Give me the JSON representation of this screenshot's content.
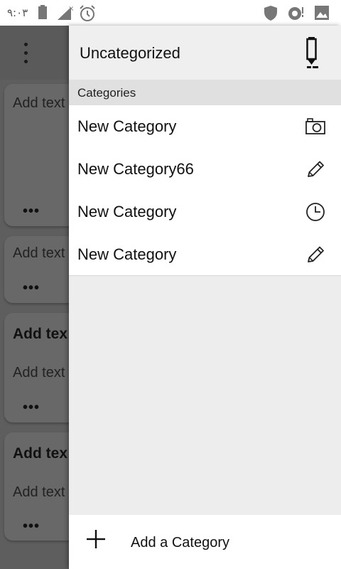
{
  "status_bar": {
    "time": "۹:۰۳",
    "icons": [
      "battery-icon",
      "no-signal-icon",
      "alarm-icon",
      "shield-icon",
      "sync-icon",
      "image-icon"
    ]
  },
  "background": {
    "menu_icon": "overflow-menu-icon",
    "cards": [
      {
        "title": "",
        "text": "Add text",
        "more": "•••"
      },
      {
        "title": "",
        "text": "Add text",
        "more": "•••"
      },
      {
        "title": "Add tex",
        "text": "Add text",
        "more": "•••"
      },
      {
        "title": "Add tex",
        "text": "Add text",
        "more": "•••"
      }
    ]
  },
  "drawer": {
    "title": "Uncategorized",
    "header_icon": "pen-icon",
    "section_label": "Categories",
    "categories": [
      {
        "label": "New Category",
        "icon": "camera-icon"
      },
      {
        "label": "New Category66",
        "icon": "pencil-icon"
      },
      {
        "label": "New Category",
        "icon": "clock-icon"
      },
      {
        "label": "New Category",
        "icon": "pencil-icon"
      }
    ],
    "add_label": "Add a Category",
    "add_icon": "plus-icon"
  },
  "colors": {
    "drawer_bg": "#ededed",
    "section_bg": "#e0e0e0",
    "scrim": "#5e5e5e"
  }
}
